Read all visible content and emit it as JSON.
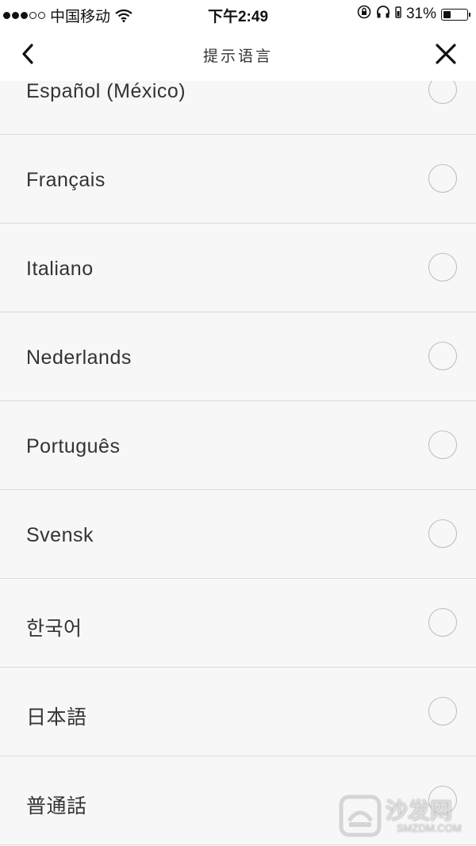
{
  "status_bar": {
    "carrier": "中国移动",
    "time": "下午2:49",
    "battery_percent": "31%",
    "battery_level": 0.31
  },
  "nav": {
    "title": "提示语言"
  },
  "languages": [
    {
      "label": "Español (México)",
      "selected": false
    },
    {
      "label": "Français",
      "selected": false
    },
    {
      "label": "Italiano",
      "selected": false
    },
    {
      "label": "Nederlands",
      "selected": false
    },
    {
      "label": "Português",
      "selected": false
    },
    {
      "label": "Svensk",
      "selected": false
    },
    {
      "label": "한국어",
      "selected": false
    },
    {
      "label": "日本語",
      "selected": false
    },
    {
      "label": "普通話",
      "selected": false
    }
  ],
  "watermark": {
    "title": "沙发网",
    "subtitle": "SMZDM.COM"
  }
}
